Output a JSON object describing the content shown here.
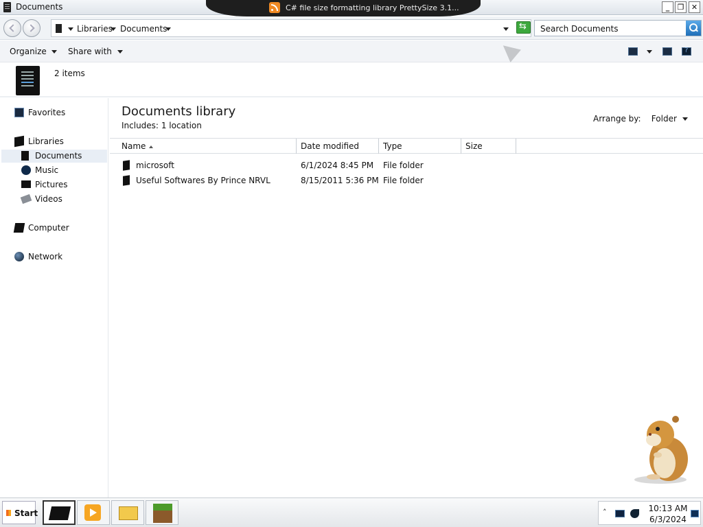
{
  "window": {
    "title": "Documents",
    "notification": "C# file size formatting library PrettySize 3.1..."
  },
  "address": {
    "crumbs": [
      "Libraries",
      "Documents"
    ],
    "search_placeholder": "Search Documents"
  },
  "toolbar": {
    "organize": "Organize",
    "share_with": "Share with"
  },
  "details": {
    "count": "2 items"
  },
  "sidebar": {
    "favorites": "Favorites",
    "libraries": "Libraries",
    "library_items": [
      "Documents",
      "Music",
      "Pictures",
      "Videos"
    ],
    "computer": "Computer",
    "network": "Network"
  },
  "main": {
    "title": "Documents library",
    "includes_label": "Includes:",
    "includes_link": "1 location",
    "arrange_label": "Arrange by:",
    "arrange_value": "Folder",
    "columns": [
      "Name",
      "Date modified",
      "Type",
      "Size"
    ],
    "rows": [
      {
        "name": "microsoft",
        "date": "6/1/2024 8:45 PM",
        "type": "File folder",
        "size": ""
      },
      {
        "name": "Useful Softwares By Prince NRVL",
        "date": "8/15/2011 5:36 PM",
        "type": "File folder",
        "size": ""
      }
    ]
  },
  "taskbar": {
    "start": "Start",
    "time": "10:13 AM",
    "date": "6/3/2024"
  }
}
